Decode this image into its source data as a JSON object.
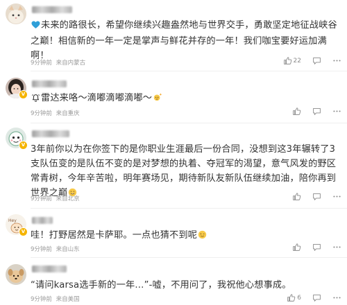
{
  "comments": [
    {
      "text": "未来的路很长，希望你继续兴趣盎然地与世界交手，勇敢坚定地征战峡谷之巅！相信新的一年一定是掌声与鲜花并存的一年！我们咖宝要好运加满啊！",
      "time": "9分钟前",
      "location": "来自内蒙古",
      "likes": "22",
      "icons": {
        "avatar": "cat-avatar-icon",
        "lead": "blue-heart-icon"
      }
    },
    {
      "text": "雷达来咯～滴嘟滴嘟滴嘟～",
      "time": "9分钟前",
      "location": "来自重庆",
      "likes": "",
      "icons": {
        "avatar": "girl-avatar-icon",
        "lead": "alarm-bell-icon",
        "trail": "sparkle-emoji-icon"
      }
    },
    {
      "text": "3年前你以为在你签下的是你职业生涯最后一份合同，没想到这3年辗转了3支队伍变的是队伍不变的是对梦想的执着、夺冠军的渴望，意气风发的野区常青树，今年辛苦啦，明年赛场见，期待新队友新队伍继续加油，陪你再到世界之巅",
      "time": "9分钟前",
      "location": "来自北京",
      "likes": "",
      "icons": {
        "avatar": "cartoon-avatar-icon",
        "heart": "red-heart-emoji-icon",
        "laugh": "laughing-emoji-icon",
        "trail": "smile-emoji-icon"
      }
    },
    {
      "text": "哇！打野居然是卡萨耶。一点也猜不到呢",
      "time": "9分钟前",
      "location": "来自山东",
      "likes": "",
      "icons": {
        "avatar": "sticker-avatar-icon",
        "trail": "wink-emoji-icon"
      }
    },
    {
      "text": "“请问karsa选手新的一年…”-嘘，不用问了，我祝他心想事成。",
      "time": "9分钟前",
      "location": "来自美国",
      "likes": "6",
      "icons": {
        "avatar": "dog-avatar-icon"
      }
    }
  ],
  "colors": {
    "text": "#333333",
    "meta": "#9b9b9b",
    "badge": "#f5b400",
    "divider": "#efefef"
  }
}
